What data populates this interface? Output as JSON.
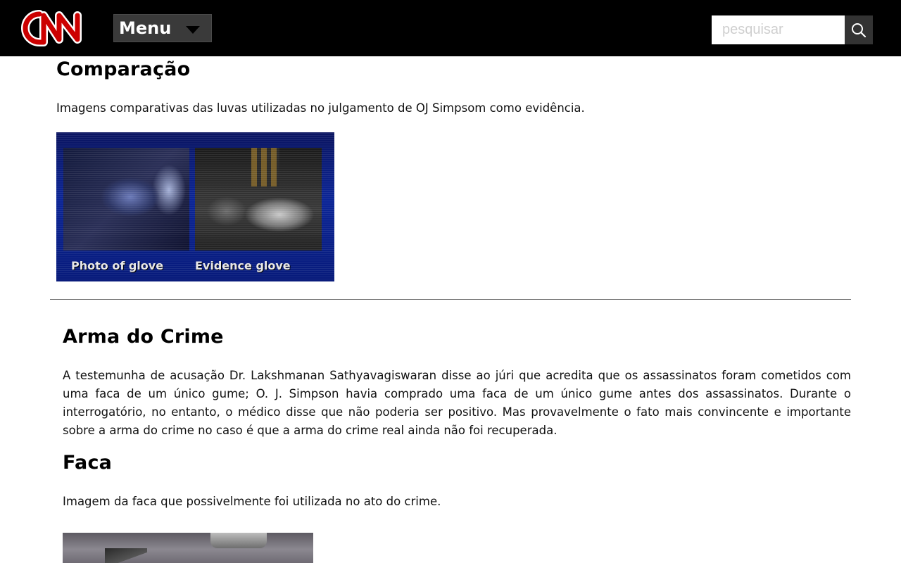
{
  "header": {
    "logo_text": "CNN",
    "menu_label": "Menu",
    "search_placeholder": "pesquisar",
    "colors": {
      "bar": "#000000",
      "logo": "#cc0000",
      "menu_bg": "#3a3a3a"
    }
  },
  "comparacao": {
    "title": "Comparação",
    "description": "Imagens comparativas das luvas utilizadas no julgamento de OJ Simpsom como evidência.",
    "image": {
      "caption_left": "Photo of glove",
      "caption_right": "Evidence glove"
    }
  },
  "arma": {
    "title": "Arma do Crime",
    "body": "A testemunha de acusação Dr. Lakshmanan Sathyavagiswaran disse ao júri que acredita que os assassinatos foram cometidos com uma faca de um único gume; O. J. Simpson havia comprado uma faca de um único gume antes dos assassinatos. Durante o interrogatório, no entanto, o médico disse que não poderia ser positivo. Mas provavelmente o fato mais convincente e importante sobre a arma do crime no caso é que a arma do crime real ainda não foi recuperada."
  },
  "faca": {
    "title": "Faca",
    "description": "Imagem da faca que possivelmente foi utilizada no ato do crime."
  }
}
